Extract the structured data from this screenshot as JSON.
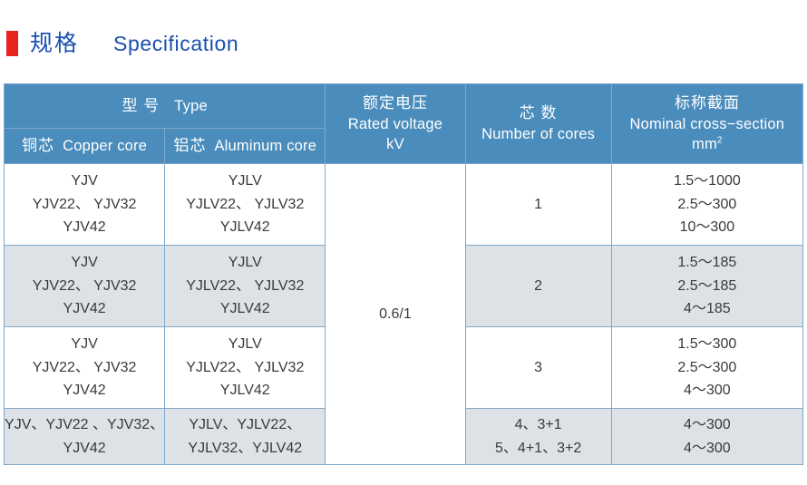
{
  "section": {
    "bullet_color": "#e8251a",
    "title_cn": "规格",
    "title_en": "Specification",
    "title_color": "#1a4fae"
  },
  "table": {
    "header_bg": "#4a8cbb",
    "shaded_row_bg": "#dce2e6",
    "border_color": "#7fa9cc",
    "groups": {
      "type_cn": "型 号",
      "type_en": "Type"
    },
    "columns": [
      {
        "cn": "铜芯",
        "en": "Copper core"
      },
      {
        "cn": "铝芯",
        "en": "Aluminum core"
      },
      {
        "cn": "额定电压",
        "en_line1": "Rated voltage",
        "en_line2": "kV"
      },
      {
        "cn": "芯 数",
        "en_line1": "Number of cores"
      },
      {
        "cn": "标称截面",
        "en_line1": "Nominal cross−section",
        "en_line2": "mm",
        "en_sup": "2"
      }
    ],
    "rated_voltage_value": "0.6/1",
    "rows": [
      {
        "copper": [
          "YJV",
          "YJV22、 YJV32",
          "YJV42"
        ],
        "aluminum": [
          "YJLV",
          "YJLV22、 YJLV32",
          "YJLV42"
        ],
        "cores": [
          "1"
        ],
        "cross_section": [
          "1.5～1000",
          "2.5～300",
          "10～300"
        ],
        "shaded": false
      },
      {
        "copper": [
          "YJV",
          "YJV22、 YJV32",
          "YJV42"
        ],
        "aluminum": [
          "YJLV",
          "YJLV22、 YJLV32",
          "YJLV42"
        ],
        "cores": [
          "2"
        ],
        "cross_section": [
          "1.5～185",
          "2.5～185",
          "4～185"
        ],
        "shaded": true
      },
      {
        "copper": [
          "YJV",
          "YJV22、 YJV32",
          "YJV42"
        ],
        "aluminum": [
          "YJLV",
          "YJLV22、 YJLV32",
          "YJLV42"
        ],
        "cores": [
          "3"
        ],
        "cross_section": [
          "1.5～300",
          "2.5～300",
          "4～300"
        ],
        "shaded": false
      },
      {
        "copper": [
          "YJV、YJV22 、YJV32、",
          "YJV42"
        ],
        "aluminum": [
          "YJLV、YJLV22、",
          "YJLV32、YJLV42"
        ],
        "cores": [
          "4、3+1",
          "5、4+1、3+2"
        ],
        "cross_section": [
          "4～300",
          "4～300"
        ],
        "shaded": true
      }
    ]
  }
}
